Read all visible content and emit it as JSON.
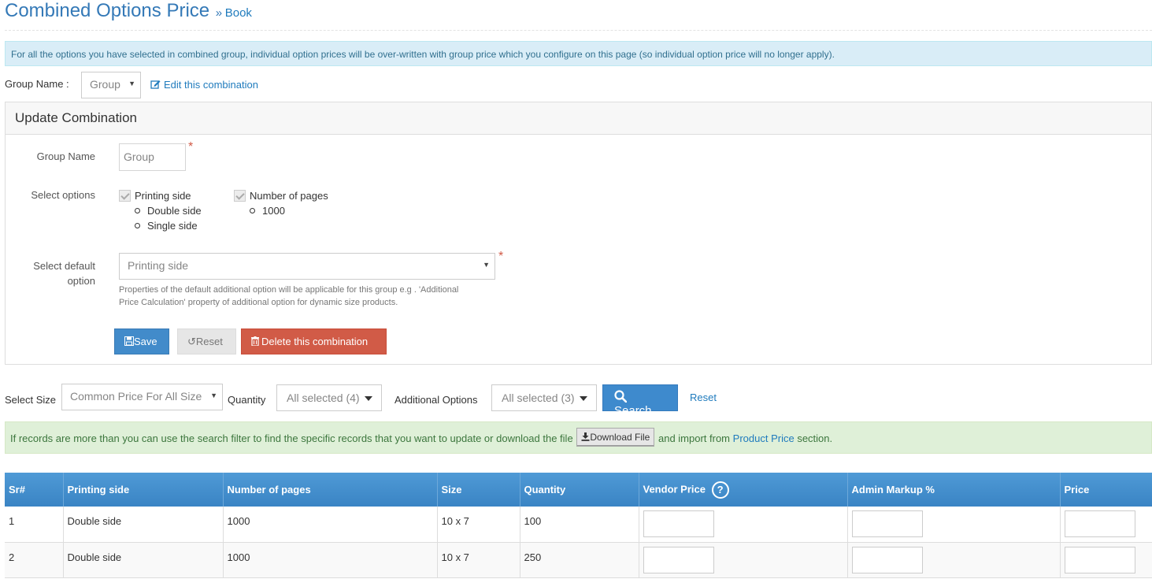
{
  "header": {
    "title": "Combined Options Price",
    "separator": "»",
    "subtitle": "Book"
  },
  "info_note": "For all the options you have selected in combined group, individual option prices will be over-written with group price which you configure on this page (so individual option price will no longer apply).",
  "group_select": {
    "label": "Group Name :",
    "value": "Group",
    "edit_label": "Edit this combination",
    "edit_icon": "edit-icon"
  },
  "panel": {
    "title": "Update Combination",
    "group_name_label": "Group Name",
    "group_name_value": "Group",
    "required_mark": "*",
    "select_options_label": "Select options",
    "options": [
      {
        "label": "Printing side",
        "checked": true,
        "items": [
          "Double side",
          "Single side"
        ]
      },
      {
        "label": "Number of pages",
        "checked": true,
        "items": [
          "1000"
        ]
      }
    ],
    "default_option_label_line1": "Select default",
    "default_option_label_line2": "option",
    "default_option_value": "Printing side",
    "help_line1": "Properties of the default additional option will be applicable for this group e.g . 'Additional",
    "help_line2": "Price Calculation' property of additional option for dynamic size products.",
    "save_label": "Save",
    "reset_label": "Reset",
    "delete_label": "Delete this combination"
  },
  "filters": {
    "size_label": "Select Size",
    "size_value": "Common Price For All Size",
    "quantity_label": "Quantity",
    "quantity_value": "All selected (4)",
    "additional_label": "Additional Options",
    "additional_value": "All selected (3)",
    "search_label": "Search",
    "reset_label": "Reset"
  },
  "success_note": {
    "text_before": "If records are more than you can use the search filter to find the specific records that you want to update or download the file",
    "download_label": "Download File",
    "text_middle": "and import from",
    "link_label": "Product Price",
    "text_after": "section."
  },
  "table": {
    "columns": [
      "Sr#",
      "Printing side",
      "Number of pages",
      "Size",
      "Quantity",
      "Vendor Price",
      "Admin Markup %",
      "Price"
    ],
    "help_glyph": "?",
    "rows": [
      {
        "sr": "1",
        "printing_side": "Double side",
        "pages": "1000",
        "size": "10 x 7",
        "quantity": "100"
      },
      {
        "sr": "2",
        "printing_side": "Double side",
        "pages": "1000",
        "size": "10 x 7",
        "quantity": "250"
      }
    ]
  },
  "colors": {
    "primary": "#428bca",
    "danger": "#d15b47",
    "info_bg": "#d9edf7",
    "success_bg": "#dff0d8",
    "title": "#3479b7"
  }
}
